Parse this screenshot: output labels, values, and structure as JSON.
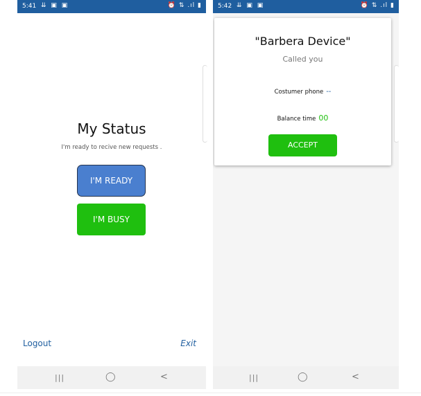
{
  "left": {
    "statusbar": {
      "time": "5:41",
      "left_icons": "⇊ ▣ ▣",
      "right_icons": "⏰ ⇅ .ıl ▮"
    },
    "title": "My Status",
    "subtitle": "I'm ready to recive new requests .",
    "ready_label": "I'M READY",
    "busy_label": "I'M BUSY",
    "logout_label": "Logout",
    "exit_label": "Exit",
    "nav": {
      "recent": "|||",
      "home": "◯",
      "back": "<"
    }
  },
  "right": {
    "statusbar": {
      "time": "5:42",
      "left_icons": "⇊ ▣ ▣",
      "right_icons": "⏰ ⇅ .ıl ▮"
    },
    "dialog": {
      "title": "\"Barbera Device\"",
      "subtitle": "Called you",
      "phone_label": "Costumer phone",
      "phone_value": "--",
      "balance_label": "Balance time",
      "balance_value": "00",
      "accept_label": "ACCEPT"
    },
    "nav": {
      "recent": "|||",
      "home": "◯",
      "back": "<"
    }
  },
  "colors": {
    "statusbar": "#1f5e9f",
    "ready_button": "#4a7fcf",
    "green_button": "#1fbf0f",
    "link": "#1f5e9f"
  }
}
